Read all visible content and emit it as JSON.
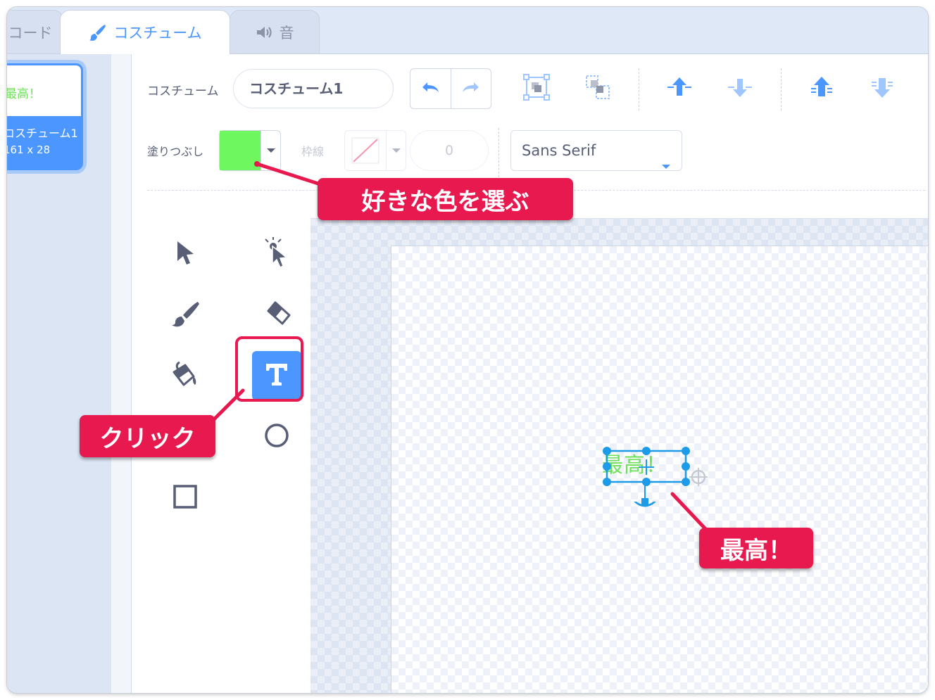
{
  "tabs": [
    {
      "label": "コード"
    },
    {
      "label": "コスチューム"
    },
    {
      "label": "音"
    }
  ],
  "costume_list": {
    "thumb_text": "最高！",
    "name": "コスチューム1",
    "size": "161 x 28"
  },
  "toolbar": {
    "costume_label": "コスチューム",
    "costume_name_value": "コスチューム1",
    "undo_icon": "undo-icon",
    "redo_icon": "redo-icon",
    "group_icon": "group-icon",
    "ungroup_icon": "ungroup-icon",
    "forward_icon": "forward-icon",
    "backward_icon": "backward-icon",
    "front_icon": "front-icon",
    "back_icon": "back-icon",
    "fill_label": "塗りつぶし",
    "fill_color": "#6ef75e",
    "outline_label": "枠線",
    "outline_width": "0",
    "font_value": "Sans Serif"
  },
  "tools": [
    "select",
    "reshape",
    "brush",
    "eraser",
    "fill",
    "text",
    "circle",
    "rectangle"
  ],
  "canvas": {
    "text": "最高！",
    "text_color": "#6ee05a",
    "selection_color": "#1e9be8"
  },
  "annotations": {
    "choose_color": "好きな色を選ぶ",
    "click": "クリック",
    "best": "最高！",
    "color": "#e8194f"
  }
}
